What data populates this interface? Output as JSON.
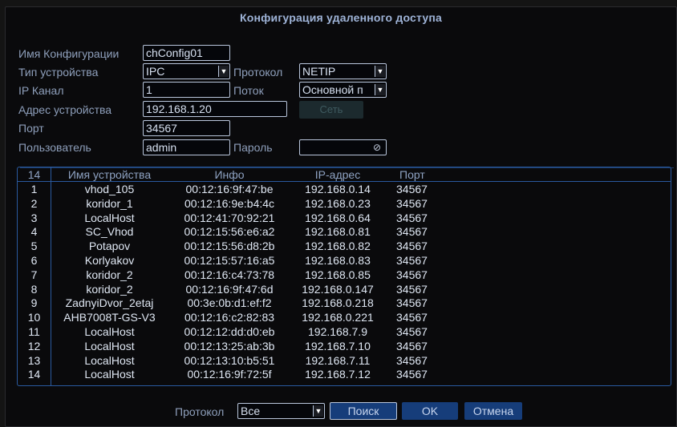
{
  "title": "Конфигурация удаленного доступа",
  "form": {
    "config_name_label": "Имя Конфигурации",
    "config_name_value": "chConfig01",
    "device_type_label": "Тип устройства",
    "device_type_value": "IPC",
    "protocol_label": "Протокол",
    "protocol_value": "NETIP",
    "ip_channel_label": "IP Канал",
    "ip_channel_value": "1",
    "stream_label": "Поток",
    "stream_value": "Основной п",
    "device_address_label": "Адрес устройства",
    "device_address_value": "192.168.1.20",
    "network_button": "Сеть",
    "port_label": "Порт",
    "port_value": "34567",
    "user_label": "Пользователь",
    "user_value": "admin",
    "password_label": "Пароль",
    "password_value": ""
  },
  "table": {
    "headers": {
      "count": "14",
      "name": "Имя устройства",
      "info": "Инфо",
      "ip": "IP-адрес",
      "port": "Порт"
    },
    "rows": [
      {
        "num": "1",
        "name": "vhod_105",
        "info": "00:12:16:9f:47:be",
        "ip": "192.168.0.14",
        "port": "34567"
      },
      {
        "num": "2",
        "name": "koridor_1",
        "info": "00:12:16:9e:b4:4c",
        "ip": "192.168.0.23",
        "port": "34567"
      },
      {
        "num": "3",
        "name": "LocalHost",
        "info": "00:12:41:70:92:21",
        "ip": "192.168.0.64",
        "port": "34567"
      },
      {
        "num": "4",
        "name": "SC_Vhod",
        "info": "00:12:15:56:e6:a2",
        "ip": "192.168.0.81",
        "port": "34567"
      },
      {
        "num": "5",
        "name": "Potapov",
        "info": "00:12:15:56:d8:2b",
        "ip": "192.168.0.82",
        "port": "34567"
      },
      {
        "num": "6",
        "name": "Korlyakov",
        "info": "00:12:15:57:16:a5",
        "ip": "192.168.0.83",
        "port": "34567"
      },
      {
        "num": "7",
        "name": "koridor_2",
        "info": "00:12:16:c4:73:78",
        "ip": "192.168.0.85",
        "port": "34567"
      },
      {
        "num": "8",
        "name": "koridor_2",
        "info": "00:12:16:9f:47:6d",
        "ip": "192.168.0.147",
        "port": "34567"
      },
      {
        "num": "9",
        "name": "ZadnyiDvor_2etaj",
        "info": "00:3e:0b:d1:ef:f2",
        "ip": "192.168.0.218",
        "port": "34567"
      },
      {
        "num": "10",
        "name": "AHB7008T-GS-V3",
        "info": "00:12:16:c2:82:83",
        "ip": "192.168.0.221",
        "port": "34567"
      },
      {
        "num": "11",
        "name": "LocalHost",
        "info": "00:12:12:dd:d0:eb",
        "ip": "192.168.7.9",
        "port": "34567"
      },
      {
        "num": "12",
        "name": "LocalHost",
        "info": "00:12:13:25:ab:3b",
        "ip": "192.168.7.10",
        "port": "34567"
      },
      {
        "num": "13",
        "name": "LocalHost",
        "info": "00:12:13:10:b5:51",
        "ip": "192.168.7.11",
        "port": "34567"
      },
      {
        "num": "14",
        "name": "LocalHost",
        "info": "00:12:16:9f:72:5f",
        "ip": "192.168.7.12",
        "port": "34567"
      }
    ]
  },
  "footer": {
    "protocol_label": "Протокол",
    "protocol_value": "Все",
    "search_button": "Поиск",
    "ok_button": "OK",
    "cancel_button": "Отмена"
  },
  "icons": {
    "dropdown": "chevron-down-icon",
    "password_toggle": "hidden-eye-icon"
  },
  "colors": {
    "accent": "#163d7a",
    "table_border": "#2a5aa0",
    "field_border": "#b9c6dc"
  }
}
